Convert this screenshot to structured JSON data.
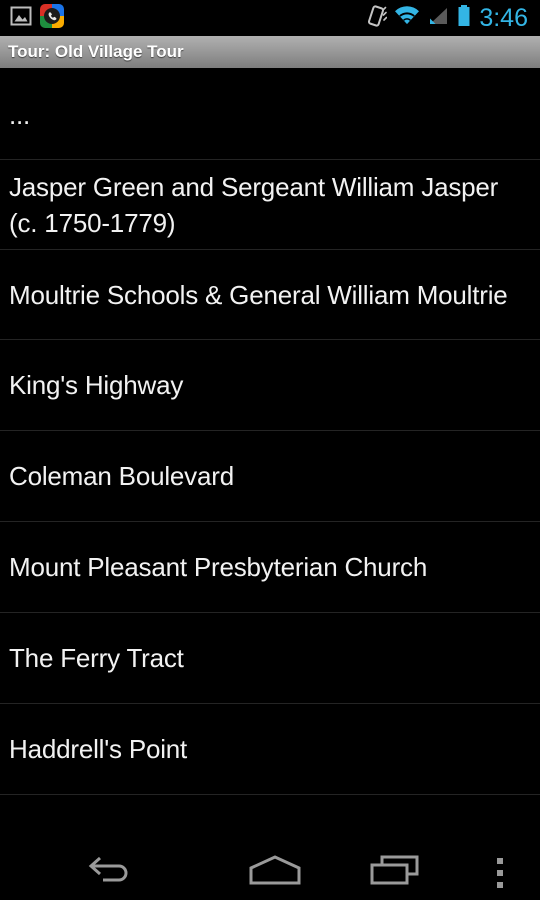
{
  "status_bar": {
    "notifications": [
      {
        "icon": "gallery-image-icon",
        "name": "screenshot-notification"
      },
      {
        "icon": "phone-app-icon",
        "name": "phone-app-notification"
      }
    ],
    "indicators": [
      {
        "icon": "vibrate-icon",
        "label": "Vibrate"
      },
      {
        "icon": "wifi-icon",
        "label": "Wi-Fi"
      },
      {
        "icon": "cellular-signal-icon",
        "label": "Cellular signal"
      },
      {
        "icon": "battery-icon",
        "label": "Battery"
      }
    ],
    "clock": "3:46",
    "accent_color": "#33b5e5"
  },
  "title_bar": {
    "title": "Tour: Old Village Tour"
  },
  "list": {
    "items": [
      {
        "label": "...",
        "style": "ellipsis"
      },
      {
        "label": "Jasper Green and Sergeant William Jasper (c. 1750-1779)",
        "style": "two-line"
      },
      {
        "label": "Moultrie Schools & General William Moultrie",
        "style": "two-line"
      },
      {
        "label": "King's Highway",
        "style": "one-line"
      },
      {
        "label": "Coleman Boulevard",
        "style": "one-line"
      },
      {
        "label": "Mount Pleasant Presbyterian Church",
        "style": "one-line"
      },
      {
        "label": "The Ferry Tract",
        "style": "one-line"
      },
      {
        "label": "Haddrell's Point",
        "style": "one-line"
      },
      {
        "label": "",
        "style": "clipped"
      }
    ],
    "text_color": "#f2f2f2",
    "divider_color": "#242424",
    "background_color": "#000000"
  },
  "nav_bar": {
    "buttons": [
      {
        "name": "back-button",
        "icon": "back-arrow-icon"
      },
      {
        "name": "home-button",
        "icon": "home-icon"
      },
      {
        "name": "recents-button",
        "icon": "recents-icon"
      },
      {
        "name": "overflow-menu-button",
        "icon": "overflow-menu-icon"
      }
    ],
    "icon_color": "#9a9a9a"
  }
}
